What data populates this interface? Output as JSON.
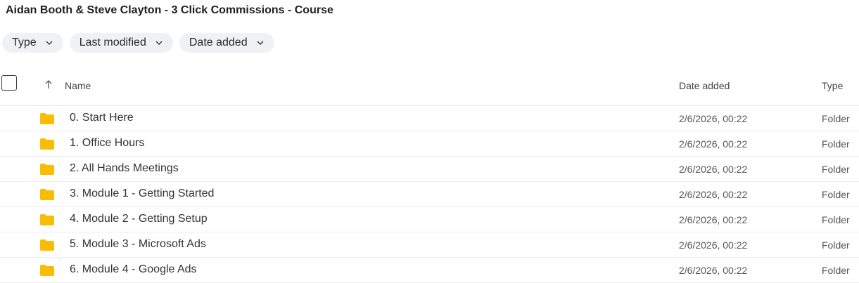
{
  "page": {
    "title": "Aidan Booth & Steve Clayton - 3 Click Commissions - Course"
  },
  "filters": [
    {
      "label": "Type",
      "icon": "chevron-down-icon"
    },
    {
      "label": "Last modified",
      "icon": "chevron-down-icon"
    },
    {
      "label": "Date added",
      "icon": "chevron-down-icon"
    }
  ],
  "table": {
    "columns": {
      "name": "Name",
      "date_added": "Date added",
      "type": "Type"
    },
    "sort_icon": "arrow-up-icon",
    "rows": [
      {
        "name": "0. Start Here",
        "date_added": "2/6/2026, 00:22",
        "type": "Folder",
        "icon": "folder-icon"
      },
      {
        "name": "1. Office Hours",
        "date_added": "2/6/2026, 00:22",
        "type": "Folder",
        "icon": "folder-icon"
      },
      {
        "name": "2. All Hands Meetings",
        "date_added": "2/6/2026, 00:22",
        "type": "Folder",
        "icon": "folder-icon"
      },
      {
        "name": "3. Module 1 - Getting Started",
        "date_added": "2/6/2026, 00:22",
        "type": "Folder",
        "icon": "folder-icon"
      },
      {
        "name": "4. Module 2 - Getting Setup",
        "date_added": "2/6/2026, 00:22",
        "type": "Folder",
        "icon": "folder-icon"
      },
      {
        "name": "5. Module 3 - Microsoft Ads",
        "date_added": "2/6/2026, 00:22",
        "type": "Folder",
        "icon": "folder-icon"
      },
      {
        "name": "6. Module 4 - Google Ads",
        "date_added": "2/6/2026, 00:22",
        "type": "Folder",
        "icon": "folder-icon"
      }
    ]
  },
  "colors": {
    "folder": "#fbbc04",
    "chip_bg": "#eff1f3"
  }
}
